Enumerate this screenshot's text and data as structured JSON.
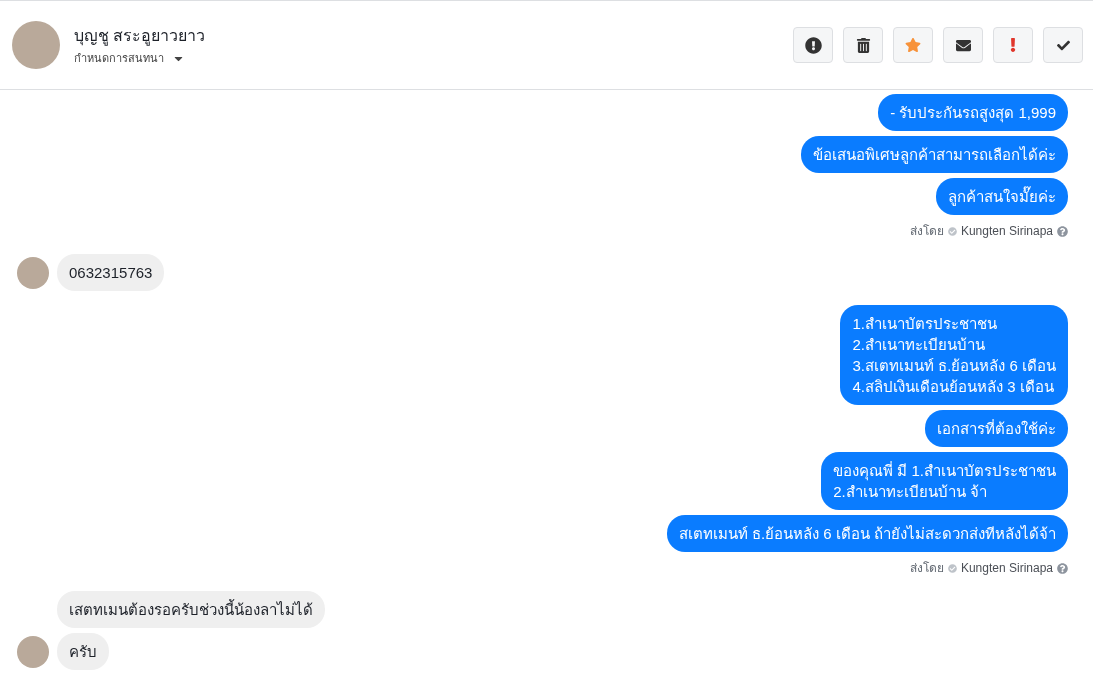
{
  "header": {
    "name": "บุญชู สระอูยาวยาว",
    "subtitle": "กำหนดการสนทนา",
    "starred": true,
    "toolbar": [
      {
        "kind": "alert"
      },
      {
        "kind": "delete"
      },
      {
        "kind": "star"
      },
      {
        "kind": "mail"
      },
      {
        "kind": "important"
      },
      {
        "kind": "done"
      }
    ]
  },
  "groups": [
    {
      "kind": "outgoing",
      "messages": [
        "- รับประกันรถสูงสุด 1,999",
        "ข้อเสนอพิเศษลูกค้าสามารถเลือกได้ค่ะ",
        "ลูกค้าสนใจมั๊ยค่ะ"
      ],
      "sent_by": {
        "label": "ส่งโดย",
        "name": "Kungten Sirinapa"
      }
    },
    {
      "kind": "incoming",
      "messages": [
        "0632315763"
      ]
    },
    {
      "kind": "outgoing",
      "messages": [
        "1.สำเนาบัตรประชาชน\n2.สำเนาทะเบียนบ้าน\n3.สเตทเมนท์ ธ.ย้อนหลัง 6 เดือน\n4.สลิปเงินเดือนย้อนหลัง 3 เดือน",
        "เอกสารที่ต้องใช้ค่ะ",
        "ของคุณพี่ มี 1.สำเนาบัตรประชาชน\n2.สำเนาทะเบียนบ้าน จ้า",
        "สเตทเมนท์ ธ.ย้อนหลัง 6 เดือน ถ้ายังไม่สะดวกส่งทีหลังได้จ้า"
      ],
      "sent_by": {
        "label": "ส่งโดย",
        "name": "Kungten Sirinapa"
      }
    },
    {
      "kind": "incoming",
      "messages": [
        "เสตทเมนต้องรอครับช่วงนี้น้องลาไม่ได้",
        "ครับ"
      ]
    }
  ]
}
